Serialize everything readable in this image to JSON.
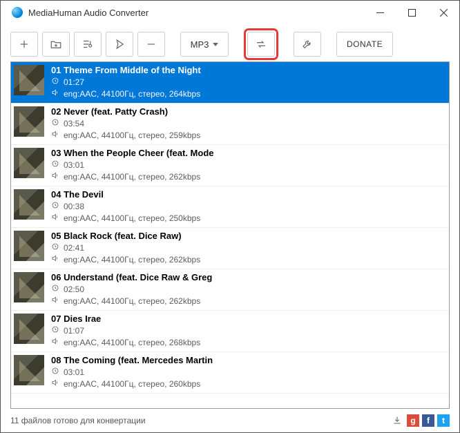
{
  "window": {
    "title": "MediaHuman Audio Converter"
  },
  "toolbar": {
    "format_label": "MP3",
    "donate_label": "DONATE"
  },
  "tracks": [
    {
      "title": "01 Theme From Middle of the Night",
      "duration": "01:27",
      "codec": "eng:AAC, 44100Гц, стерео, 264kbps",
      "selected": true
    },
    {
      "title": "02 Never (feat. Patty Crash)",
      "duration": "03:54",
      "codec": "eng:AAC, 44100Гц, стерео, 259kbps",
      "selected": false
    },
    {
      "title": "03 When the People Cheer (feat. Mode",
      "duration": "03:01",
      "codec": "eng:AAC, 44100Гц, стерео, 262kbps",
      "selected": false
    },
    {
      "title": "04 The Devil",
      "duration": "00:38",
      "codec": "eng:AAC, 44100Гц, стерео, 250kbps",
      "selected": false
    },
    {
      "title": "05 Black Rock (feat. Dice Raw)",
      "duration": "02:41",
      "codec": "eng:AAC, 44100Гц, стерео, 262kbps",
      "selected": false
    },
    {
      "title": "06 Understand (feat. Dice Raw & Greg",
      "duration": "02:50",
      "codec": "eng:AAC, 44100Гц, стерео, 262kbps",
      "selected": false
    },
    {
      "title": "07 Dies Irae",
      "duration": "01:07",
      "codec": "eng:AAC, 44100Гц, стерео, 268kbps",
      "selected": false
    },
    {
      "title": "08 The Coming (feat. Mercedes Martin",
      "duration": "03:01",
      "codec": "eng:AAC, 44100Гц, стерео, 260kbps",
      "selected": false
    }
  ],
  "status": {
    "text": "11 файлов готово для конвертации"
  }
}
